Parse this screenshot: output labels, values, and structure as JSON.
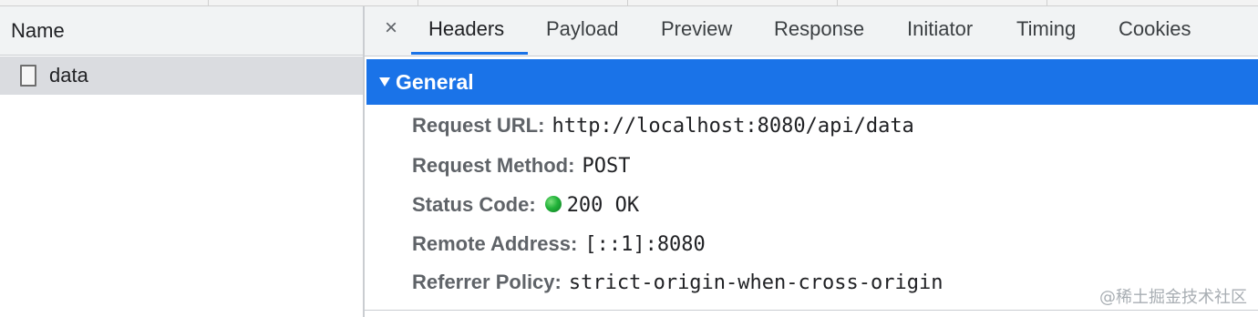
{
  "left_panel": {
    "column_header": "Name",
    "requests": [
      {
        "name": "data"
      }
    ]
  },
  "detail": {
    "close_label": "×",
    "tabs": [
      "Headers",
      "Payload",
      "Preview",
      "Response",
      "Initiator",
      "Timing",
      "Cookies"
    ],
    "active_tab": "Headers",
    "section_title": "General",
    "rows": [
      {
        "key": "Request URL:",
        "value": "http://localhost:8080/api/data"
      },
      {
        "key": "Request Method:",
        "value": "POST"
      },
      {
        "key": "Status Code:",
        "value": "200 OK",
        "status_indicator": "green-dot"
      },
      {
        "key": "Remote Address:",
        "value": "[::1]:8080"
      },
      {
        "key": "Referrer Policy:",
        "value": "strict-origin-when-cross-origin"
      }
    ]
  },
  "watermark": "@稀土掘金技术社区",
  "colors": {
    "accent": "#1a73e8",
    "selected_row": "#dadce0",
    "header_bg": "#f1f3f4",
    "status_green": "#22b33a"
  }
}
